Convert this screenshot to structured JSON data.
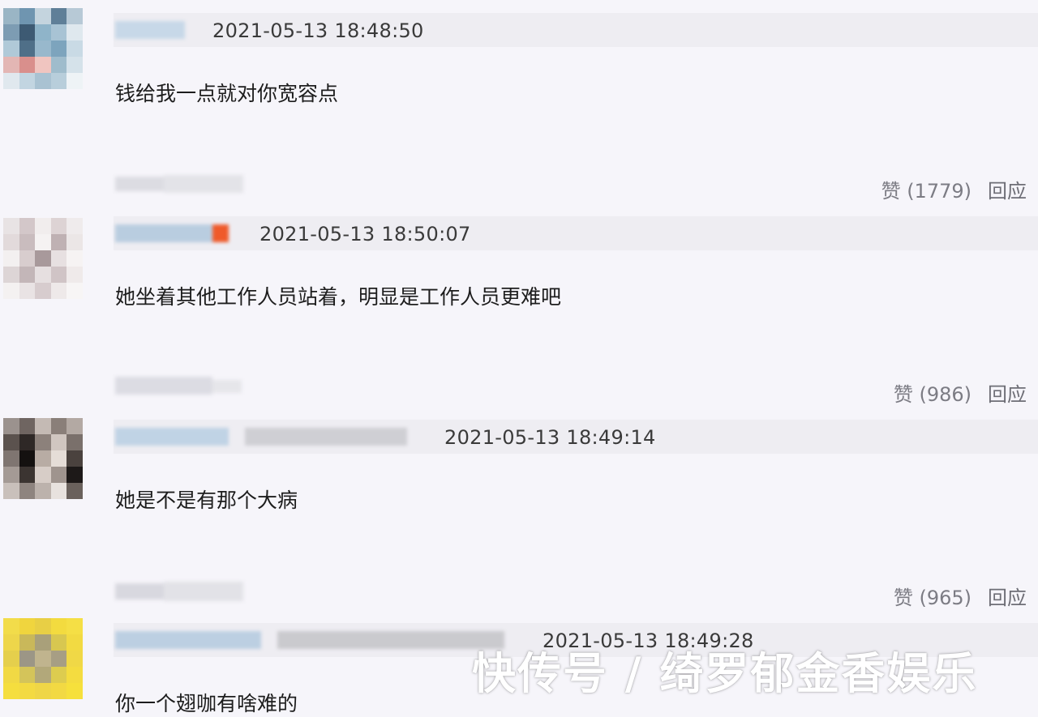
{
  "comments": [
    {
      "timestamp": "2021-05-13 18:48:50",
      "text": "钱给我一点就对你宽容点",
      "likes_label": "赞 (1779)",
      "reply_label": "回应"
    },
    {
      "timestamp": "2021-05-13 18:50:07",
      "text": "她坐着其他工作人员站着，明显是工作人员更难吧",
      "likes_label": "赞 (986)",
      "reply_label": "回应"
    },
    {
      "timestamp": "2021-05-13 18:49:14",
      "text": "她是不是有那个大病",
      "likes_label": "赞 (965)",
      "reply_label": "回应"
    },
    {
      "timestamp": "2021-05-13 18:49:28",
      "text": "你一个翅咖有啥难的"
    }
  ],
  "watermark": "快传号 / 绮罗郁金香娱乐",
  "colors": {
    "background": "#f6f5fa",
    "header_bar": "#eeedf2",
    "action_text": "#7c7c84",
    "watermark": "#ffffff"
  }
}
